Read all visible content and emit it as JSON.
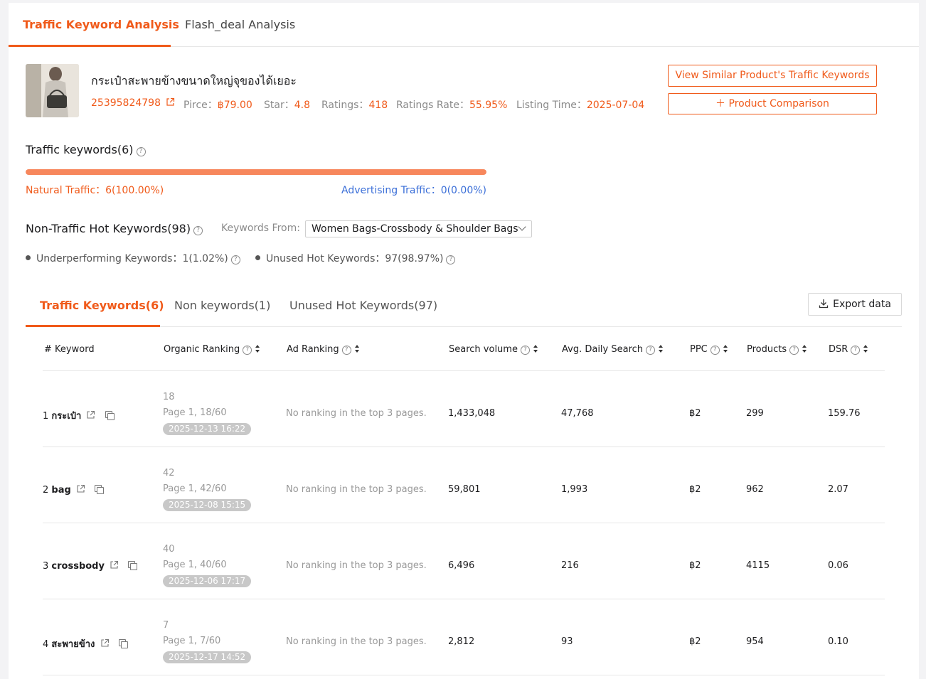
{
  "top_tabs": [
    {
      "label": "Traffic Keyword Analysis",
      "active": true
    },
    {
      "label": "Flash_deal Analysis",
      "active": false
    }
  ],
  "product": {
    "title": "กระเป๋าสะพายข้างขนาดใหญ่จุของได้เยอะ",
    "id": "25395824798",
    "price_label": "Pirce：",
    "price": "฿79.00",
    "star_label": "Star：",
    "star": "4.8",
    "ratings_label": "Ratings：",
    "ratings": "418",
    "ratings_rate_label": "Ratings Rate：",
    "ratings_rate": "55.95%",
    "listing_label": "Listing Time：",
    "listing_time": "2025-07-04"
  },
  "buttons": {
    "similar": "View Similar Product's Traffic Keywords",
    "comparison": "＋  Product Comparison",
    "export": "Export data"
  },
  "traffic": {
    "title": "Traffic keywords(6)",
    "natural_label": "Natural Traffic：6(100.00%)",
    "advertising_label": "Advertising Traffic：0(0.00%)",
    "natural_fraction": 1.0
  },
  "non_traffic": {
    "title": "Non-Traffic Hot Keywords(98)",
    "keywords_from_label": "Keywords From:",
    "keywords_from_value": "Women Bags-Crossbody & Shoulder Bags",
    "underperforming": "Underperforming Keywords：1(1.02%)",
    "unused": "Unused Hot Keywords：97(98.97%)"
  },
  "sub_tabs": [
    {
      "label": "Traffic Keywords(6)",
      "active": true
    },
    {
      "label": "Non keywords(1)",
      "active": false
    },
    {
      "label": "Unused Hot Keywords(97)",
      "active": false
    }
  ],
  "table": {
    "headers": {
      "hash": "#",
      "keyword": "Keyword",
      "organic": "Organic Ranking",
      "ad": "Ad Ranking",
      "search_volume": "Search volume",
      "avg_daily": "Avg. Daily Search",
      "ppc": "PPC",
      "products": "Products",
      "dsr": "DSR"
    },
    "rows": [
      {
        "index": "1",
        "keyword": "กระเป๋า",
        "rank": "18",
        "page": "Page 1, 18/60",
        "date": "2025-12-13 16:22",
        "ad": "No ranking in the top 3 pages.",
        "search_volume": "1,433,048",
        "avg_daily": "47,768",
        "ppc": "฿2",
        "products": "299",
        "dsr": "159.76"
      },
      {
        "index": "2",
        "keyword": "bag",
        "rank": "42",
        "page": "Page 1, 42/60",
        "date": "2025-12-08 15:15",
        "ad": "No ranking in the top 3 pages.",
        "search_volume": "59,801",
        "avg_daily": "1,993",
        "ppc": "฿2",
        "products": "962",
        "dsr": "2.07"
      },
      {
        "index": "3",
        "keyword": "crossbody",
        "rank": "40",
        "page": "Page 1, 40/60",
        "date": "2025-12-06 17:17",
        "ad": "No ranking in the top 3 pages.",
        "search_volume": "6,496",
        "avg_daily": "216",
        "ppc": "฿2",
        "products": "4115",
        "dsr": "0.06"
      },
      {
        "index": "4",
        "keyword": "สะพายข้าง",
        "rank": "7",
        "page": "Page 1, 7/60",
        "date": "2025-12-17 14:52",
        "ad": "No ranking in the top 3 pages.",
        "search_volume": "2,812",
        "avg_daily": "93",
        "ppc": "฿2",
        "products": "954",
        "dsr": "0.10"
      }
    ]
  }
}
